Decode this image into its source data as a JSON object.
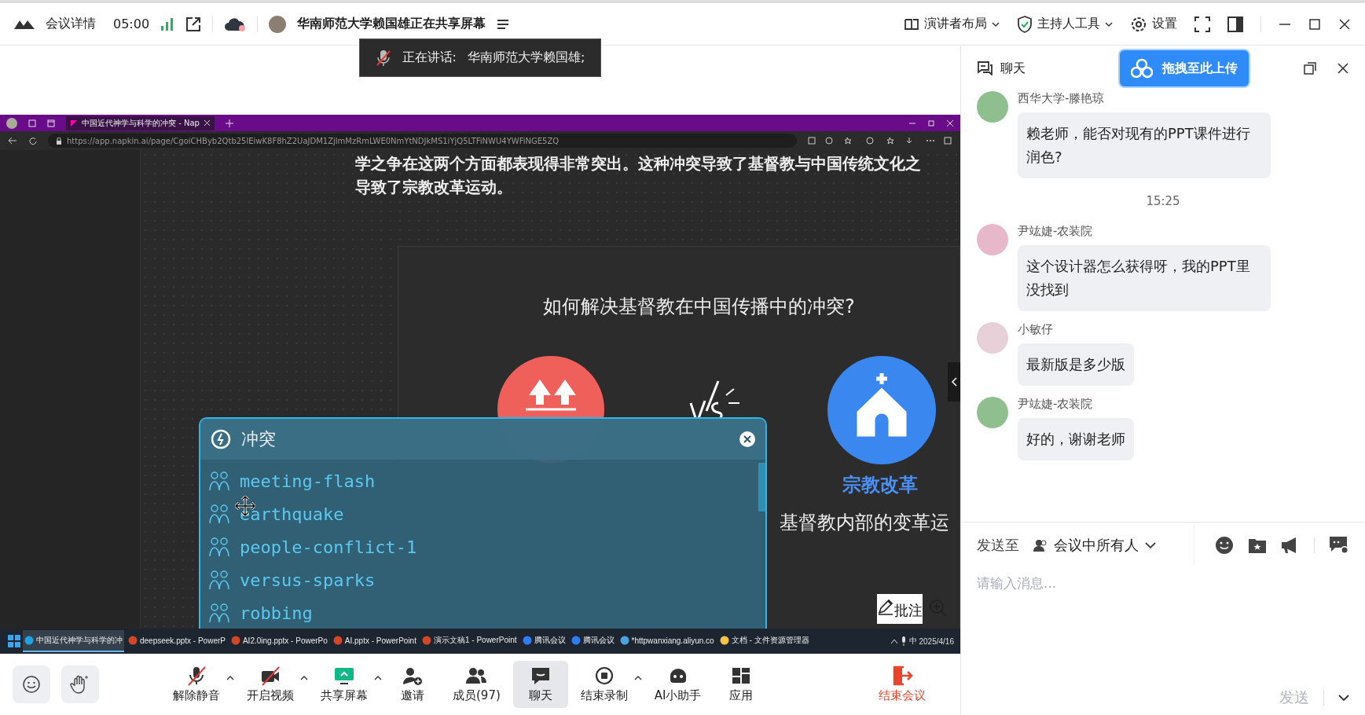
{
  "top_bar": {
    "title": "会议详情",
    "timer": "05:00",
    "sharing_notice": "华南师范大学赖国雄正在共享屏幕",
    "actions": [
      {
        "label": "演讲者布局",
        "kind": "layout",
        "has_menu": true
      },
      {
        "label": "主持人工具",
        "kind": "host",
        "has_menu": true
      },
      {
        "label": "设置",
        "kind": "settings",
        "has_menu": false
      }
    ]
  },
  "speaking_banner": {
    "label": "正在讲话:",
    "name": "华南师范大学赖国雄;"
  },
  "shared_screen": {
    "browser": {
      "tab_title": "中国近代神学与科学的冲突 - Nap",
      "url": "https://app.napkin.ai/page/CgoiCHByb2Qtb25lEiwK8F8hZ2UaJDM1ZjlmMzRmLWE0NmYtNDJkMS1iYjQ5LTFiNWU4YWFiNGE5ZQ"
    },
    "document": {
      "paragraph_lines": [
        "学之争在这两个方面都表现得非常突出。这种冲突导致了基督教与中国传统文化之",
        "导致了宗教改革运动。"
      ],
      "card_title": "如何解决基督教在中国传播中的冲突?",
      "node_title": "宗教改革",
      "node_text": "基督教内部的变革运"
    },
    "search_popup": {
      "query": "冲突",
      "results": [
        {
          "label": "meeting-flash"
        },
        {
          "label": "earthquake"
        },
        {
          "label": "people-conflict-1"
        },
        {
          "label": "versus-sparks"
        },
        {
          "label": "robbing"
        }
      ]
    },
    "taskbar": {
      "items": [
        {
          "label": "中国近代神学与科学的冲",
          "kind": "browser",
          "selected": true
        },
        {
          "label": "deepseek.pptx - PowerP",
          "kind": "slides",
          "selected": false
        },
        {
          "label": "AI2.0ing.pptx - PowerPo",
          "kind": "slides",
          "selected": false
        },
        {
          "label": "AI.pptx - PowerPoint",
          "kind": "slides",
          "selected": false
        },
        {
          "label": "演示文稿1 - PowerPoint",
          "kind": "slides",
          "selected": false
        },
        {
          "label": "腾讯会议",
          "kind": "meeting",
          "selected": false
        },
        {
          "label": "腾讯会议",
          "kind": "meeting",
          "selected": false
        },
        {
          "label": "*httpwanxiang.aliyun.co",
          "kind": "notepad",
          "selected": false
        },
        {
          "label": "文档 - 文件资源管理器",
          "kind": "folder",
          "selected": false
        }
      ],
      "input_method": "中",
      "date": "2025/4/16"
    },
    "annotate_button": "批注"
  },
  "toolbar": {
    "items": [
      {
        "label": "解除静音",
        "kind": "mic",
        "off": true,
        "has_menu": true,
        "selected": false
      },
      {
        "label": "开启视频",
        "kind": "video",
        "off": true,
        "has_menu": true,
        "selected": false
      },
      {
        "label": "共享屏幕",
        "kind": "share",
        "off": false,
        "has_menu": true,
        "selected": false
      },
      {
        "label": "邀请",
        "kind": "invite",
        "off": false,
        "has_menu": false,
        "selected": false
      },
      {
        "label": "成员(97)",
        "kind": "members",
        "off": false,
        "has_menu": false,
        "selected": false
      },
      {
        "label": "聊天",
        "kind": "chat",
        "off": false,
        "has_menu": false,
        "selected": true
      },
      {
        "label": "结束录制",
        "kind": "record",
        "off": false,
        "has_menu": true,
        "selected": false
      },
      {
        "label": "AI小助手",
        "kind": "ai",
        "off": false,
        "has_menu": false,
        "selected": false
      },
      {
        "label": "应用",
        "kind": "apps",
        "off": false,
        "has_menu": false,
        "selected": false
      }
    ],
    "end_button": "结束会议"
  },
  "chat": {
    "title": "聊天",
    "upload_button": "拖拽至此上传",
    "messages": [
      {
        "kind": "message",
        "sender": "西华大学-滕艳琼",
        "text": "赖老师，能否对现有的PPT课件进行润色?"
      },
      {
        "kind": "time",
        "text": "15:25"
      },
      {
        "kind": "message",
        "sender": "尹竑婕-农装院",
        "text": "这个设计器怎么获得呀，我的PPT里没找到"
      },
      {
        "kind": "message",
        "sender": "小敏仔",
        "text": "最新版是多少版"
      },
      {
        "kind": "message",
        "sender": "尹竑婕-农装院",
        "text": "好的，谢谢老师"
      }
    ],
    "send_to_label": "发送至",
    "recipient": "会议中所有人",
    "placeholder": "请输入消息...",
    "send_button": "发送"
  }
}
